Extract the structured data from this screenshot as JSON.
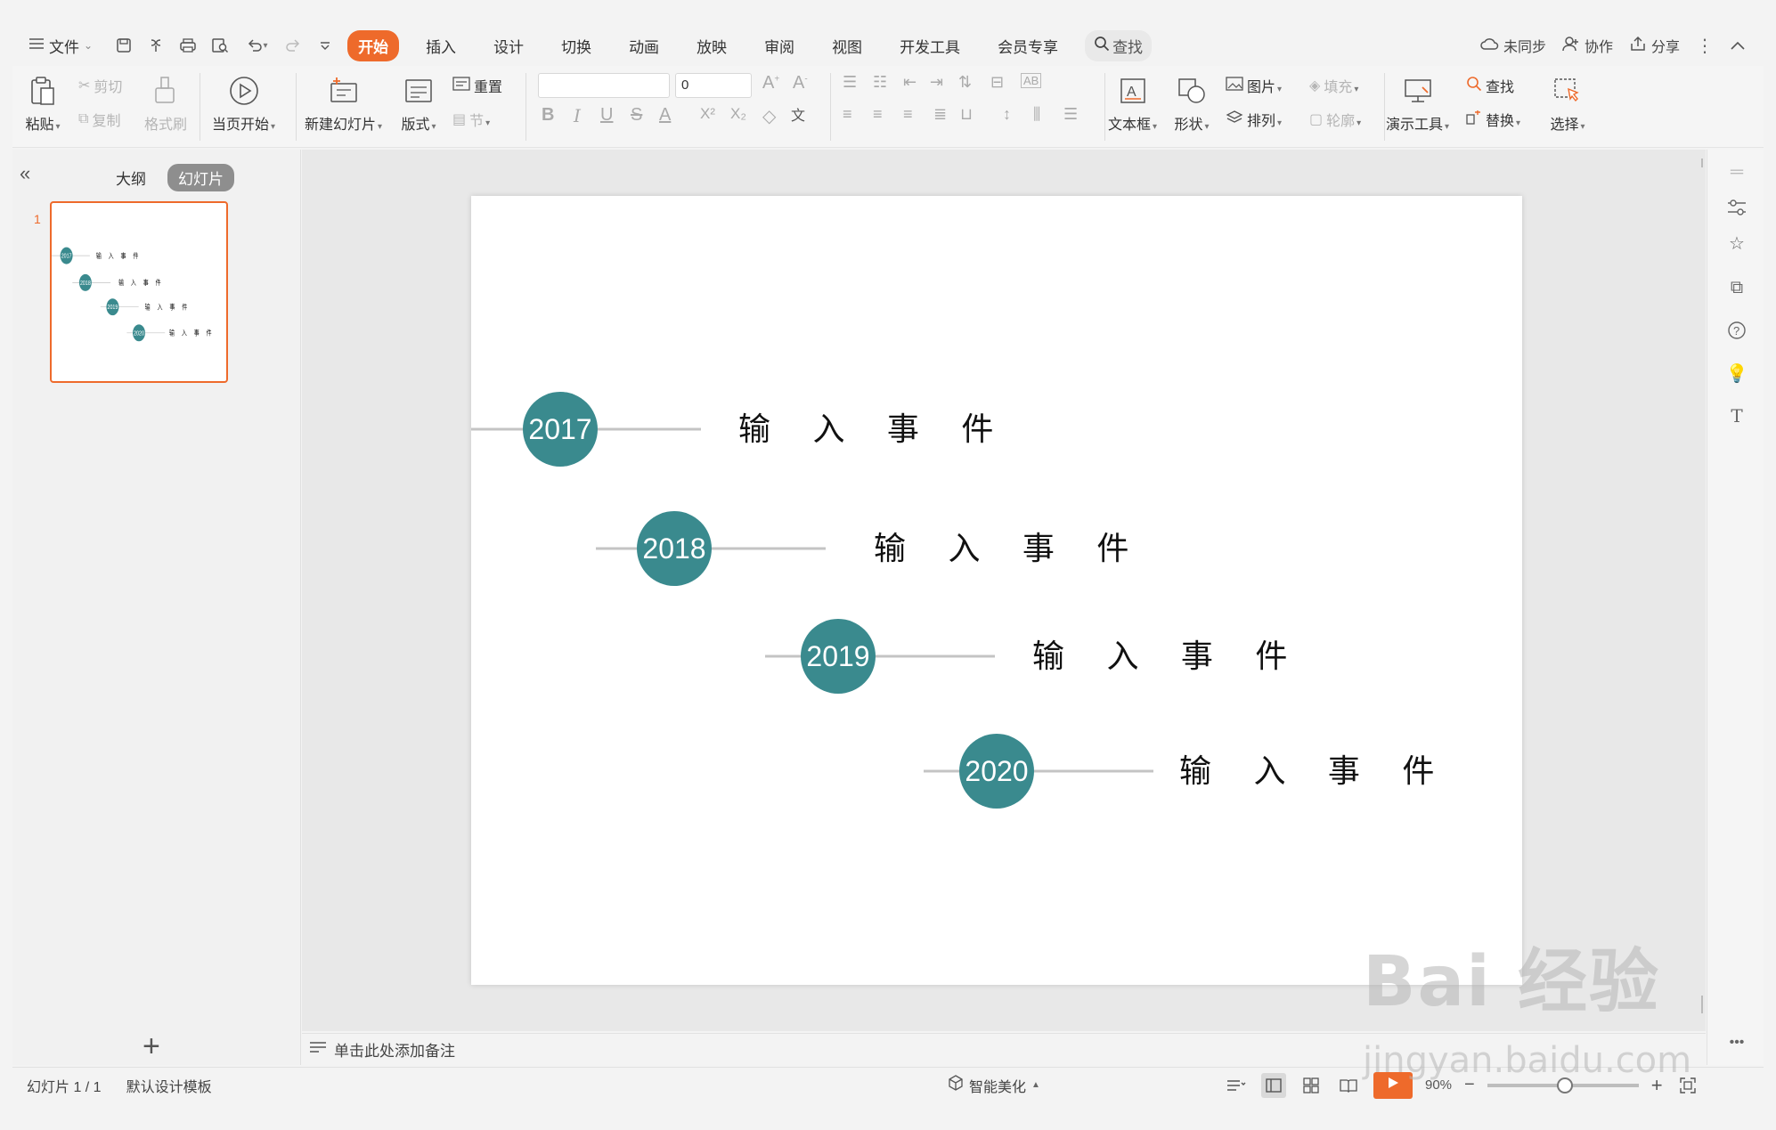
{
  "menubar": {
    "file_label": "文件",
    "tabs": [
      {
        "label": "开始",
        "active": true
      },
      {
        "label": "插入",
        "active": false
      },
      {
        "label": "设计",
        "active": false
      },
      {
        "label": "切换",
        "active": false
      },
      {
        "label": "动画",
        "active": false
      },
      {
        "label": "放映",
        "active": false
      },
      {
        "label": "审阅",
        "active": false
      },
      {
        "label": "视图",
        "active": false
      },
      {
        "label": "开发工具",
        "active": false
      },
      {
        "label": "会员专享",
        "active": false
      }
    ],
    "search_label": "查找",
    "sync_label": "未同步",
    "collab_label": "协作",
    "share_label": "分享"
  },
  "ribbon": {
    "paste": "粘贴",
    "cut": "剪切",
    "copy": "复制",
    "format_painter": "格式刷",
    "from_current": "当页开始",
    "new_slide": "新建幻灯片",
    "layout": "版式",
    "reset": "重置",
    "section": "节",
    "font_size_value": "0",
    "textbox": "文本框",
    "shape": "形状",
    "picture": "图片",
    "fill": "填充",
    "arrange": "排列",
    "outline": "轮廓",
    "present_tools": "演示工具",
    "find": "查找",
    "replace": "替换",
    "select": "选择"
  },
  "left_panel": {
    "outline_tab": "大纲",
    "slides_tab": "幻灯片",
    "slide_number": "1"
  },
  "slide": {
    "events": [
      {
        "year": "2017",
        "text": "输 入 事 件"
      },
      {
        "year": "2018",
        "text": "输 入 事 件"
      },
      {
        "year": "2019",
        "text": "输 入 事 件"
      },
      {
        "year": "2020",
        "text": "输 入 事 件"
      }
    ],
    "circle_color": "#3a8a8e",
    "line_color": "#c4c4c4"
  },
  "notes": {
    "placeholder": "单击此处添加备注"
  },
  "statusbar": {
    "slide_info": "幻灯片 1 / 1",
    "template": "默认设计模板",
    "smart_beautify": "智能美化",
    "zoom": "90%"
  },
  "watermark": {
    "brand": "Bai 经验",
    "url": "jingyan.baidu.com"
  },
  "colors": {
    "accent": "#ee6a2b"
  }
}
